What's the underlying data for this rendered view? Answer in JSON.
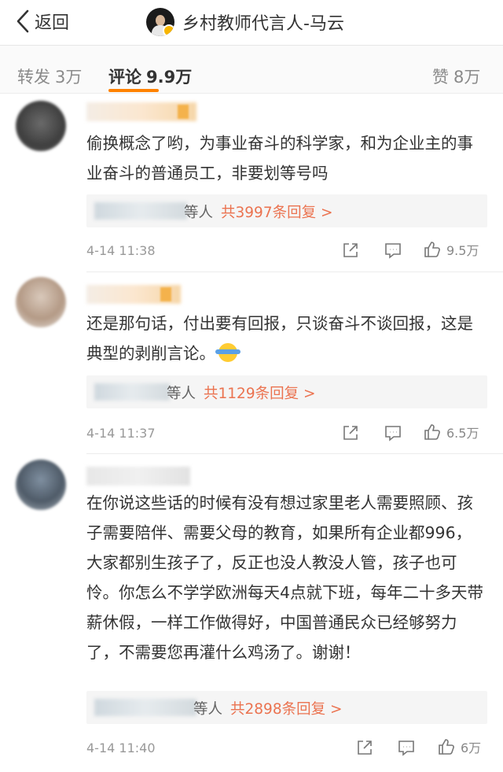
{
  "header": {
    "back_label": "返回",
    "title": "乡村教师代言人-马云"
  },
  "tabs": {
    "repost_label": "转发",
    "repost_count": "3万",
    "comment_label": "评论",
    "comment_count": "9.9万",
    "like_label": "赞",
    "like_count": "8万"
  },
  "comments": [
    {
      "text": "偷换概念了哟，为事业奋斗的科学家，和为企业主的事业奋斗的普通员工，非要划等号吗",
      "reply_who": "等人",
      "reply_count": "共3997条回复 >",
      "time": "4-14 11:38",
      "likes": "9.5万"
    },
    {
      "text": "还是那句话，付出要有回报，只谈奋斗不谈回报，这是典型的剥削言论。",
      "emoji": "shrug-emoji",
      "reply_who": "等人",
      "reply_count": "共1129条回复 >",
      "time": "4-14 11:37",
      "likes": "6.5万"
    },
    {
      "text": "在你说这些话的时候有没有想过家里老人需要照顾、孩子需要陪伴、需要父母的教育，如果所有企业都996，大家都别生孩子了，反正也没人教没人管，孩子也可怜。你怎么不学学欧洲每天4点就下班，每年二十多天带薪休假，一样工作做得好，中国普通民众已经够努力了，不需要您再灌什么鸡汤了。谢谢！",
      "reply_who": "等人",
      "reply_count": "共2898条回复 >",
      "time": "4-14 11:40",
      "likes": "6万"
    }
  ],
  "colors": {
    "accent_orange": "#ff8200",
    "reply_link": "#eb7350",
    "muted_text": "#999999"
  },
  "icons": [
    "back-chevron-icon",
    "share-icon",
    "comment-icon",
    "like-icon"
  ]
}
